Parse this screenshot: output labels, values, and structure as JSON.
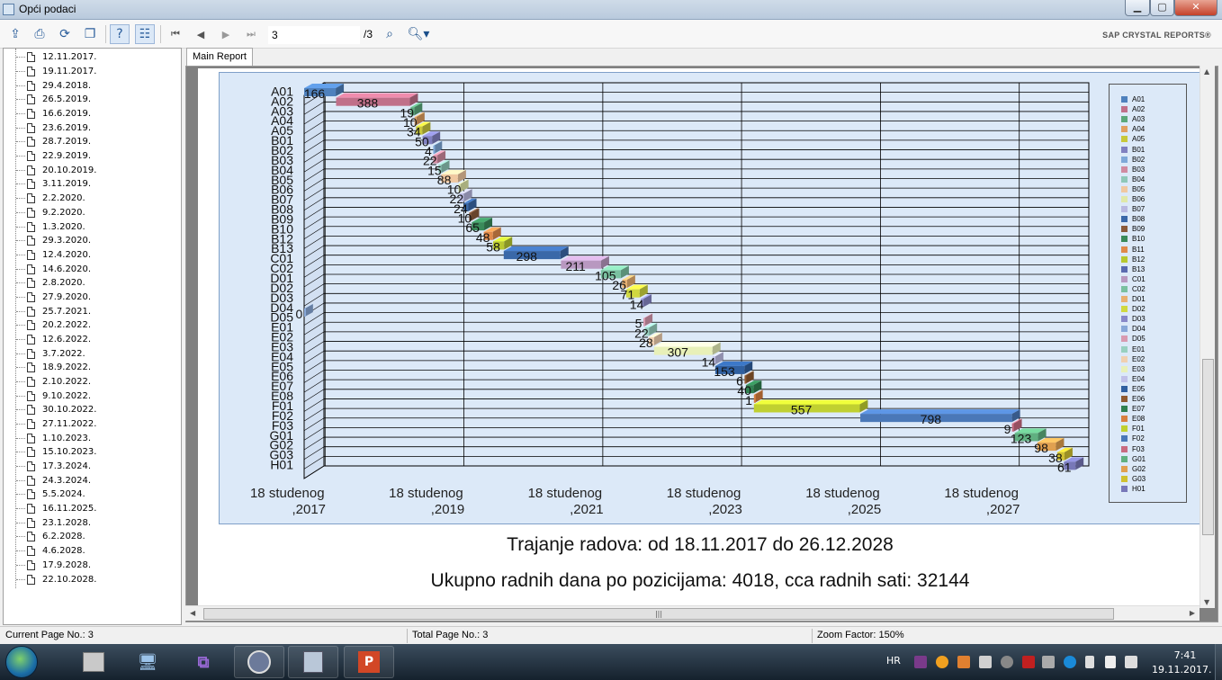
{
  "window": {
    "title": "Opći podaci"
  },
  "toolbar": {
    "page_value": "3",
    "page_total": "/3",
    "brand": "SAP CRYSTAL REPORTS®"
  },
  "tree": {
    "items": [
      "12.11.2017.",
      "19.11.2017.",
      "29.4.2018.",
      "26.5.2019.",
      "16.6.2019.",
      "23.6.2019.",
      "28.7.2019.",
      "22.9.2019.",
      "20.10.2019.",
      "3.11.2019.",
      "2.2.2020.",
      "9.2.2020.",
      "1.3.2020.",
      "29.3.2020.",
      "12.4.2020.",
      "14.6.2020.",
      "2.8.2020.",
      "27.9.2020.",
      "25.7.2021.",
      "20.2.2022.",
      "12.6.2022.",
      "3.7.2022.",
      "18.9.2022.",
      "2.10.2022.",
      "9.10.2022.",
      "30.10.2022.",
      "27.11.2022.",
      "1.10.2023.",
      "15.10.2023.",
      "17.3.2024.",
      "24.3.2024.",
      "5.5.2024.",
      "16.11.2025.",
      "23.1.2028.",
      "6.2.2028.",
      "4.6.2028.",
      "17.9.2028.",
      "22.10.2028."
    ]
  },
  "tabs": {
    "main": "Main Report"
  },
  "report": {
    "summary_duration": "Trajanje radova: od 18.11.2017 do 26.12.2028",
    "summary_workdays": "Ukupno radnih dana po pozicijama: 4018, cca radnih sati: 32144"
  },
  "chart_data": {
    "type": "bar",
    "orientation": "horizontal-gantt",
    "x_ticks": [
      {
        "line1": "18 studenog",
        "line2": ",2017"
      },
      {
        "line1": "18 studenog",
        "line2": ",2019"
      },
      {
        "line1": "18 studenog",
        "line2": ",2021"
      },
      {
        "line1": "18 studenog",
        "line2": ",2023"
      },
      {
        "line1": "18 studenog",
        "line2": ",2025"
      },
      {
        "line1": "18 studenog",
        "line2": ",2027"
      }
    ],
    "xlim": [
      "2017-11-12",
      "2028-11-18"
    ],
    "categories_shown": [
      "A01",
      "A02",
      "A03",
      "A04",
      "A05",
      "B01",
      "B02",
      "B03",
      "B04",
      "B05",
      "B06",
      "B07",
      "B08",
      "B09",
      "B10",
      "B12",
      "B13",
      "C01",
      "C02",
      "D01",
      "D02",
      "D03",
      "D04",
      "D05",
      "E01",
      "E02",
      "E03",
      "E04",
      "E05",
      "E06",
      "E07",
      "E08",
      "F01",
      "F02",
      "F03",
      "G01",
      "G02",
      "G03",
      "H01"
    ],
    "legend": [
      {
        "name": "A01",
        "color": "#4f81bd"
      },
      {
        "name": "A02",
        "color": "#c0708a"
      },
      {
        "name": "A03",
        "color": "#5aa87a"
      },
      {
        "name": "A04",
        "color": "#e0a060"
      },
      {
        "name": "A05",
        "color": "#c8c83a"
      },
      {
        "name": "B01",
        "color": "#8080c0"
      },
      {
        "name": "B02",
        "color": "#7fa8d8"
      },
      {
        "name": "B03",
        "color": "#d08aa0"
      },
      {
        "name": "B04",
        "color": "#8fc8b8"
      },
      {
        "name": "B05",
        "color": "#f0c8a0"
      },
      {
        "name": "B06",
        "color": "#e0e8a8"
      },
      {
        "name": "B07",
        "color": "#b8b8e0"
      },
      {
        "name": "B08",
        "color": "#3a68a8"
      },
      {
        "name": "B09",
        "color": "#8a5a3a"
      },
      {
        "name": "B10",
        "color": "#3a8a5a"
      },
      {
        "name": "B11",
        "color": "#e08a4a"
      },
      {
        "name": "B12",
        "color": "#b8c830"
      },
      {
        "name": "B13",
        "color": "#5a6ab0"
      },
      {
        "name": "C01",
        "color": "#b898c0"
      },
      {
        "name": "C02",
        "color": "#7ac0a0"
      },
      {
        "name": "D01",
        "color": "#e8b070"
      },
      {
        "name": "D02",
        "color": "#d0d840"
      },
      {
        "name": "D03",
        "color": "#8888c8"
      },
      {
        "name": "D04",
        "color": "#88a8d8"
      },
      {
        "name": "D05",
        "color": "#d89ab0"
      },
      {
        "name": "E01",
        "color": "#98d0c0"
      },
      {
        "name": "E02",
        "color": "#f0d0b0"
      },
      {
        "name": "E03",
        "color": "#e8f0b8"
      },
      {
        "name": "E04",
        "color": "#c0c0e8"
      },
      {
        "name": "E05",
        "color": "#3060a0"
      },
      {
        "name": "E06",
        "color": "#905a30"
      },
      {
        "name": "E07",
        "color": "#308050"
      },
      {
        "name": "E08",
        "color": "#d88040"
      },
      {
        "name": "F01",
        "color": "#c0d030"
      },
      {
        "name": "F02",
        "color": "#4a78b8"
      },
      {
        "name": "F03",
        "color": "#c86a80"
      },
      {
        "name": "G01",
        "color": "#60b080"
      },
      {
        "name": "G02",
        "color": "#e0a050"
      },
      {
        "name": "G03",
        "color": "#d0c030"
      },
      {
        "name": "H01",
        "color": "#7878b8"
      }
    ],
    "bars": [
      {
        "label": "A01",
        "start": "2017-11-12",
        "days": 166,
        "color": "#4f81bd"
      },
      {
        "label": "A02",
        "start": "2018-04-29",
        "days": 388,
        "color": "#c0708a"
      },
      {
        "label": "A03",
        "start": "2019-05-26",
        "days": 19,
        "color": "#5aa87a"
      },
      {
        "label": "A04",
        "start": "2019-06-16",
        "days": 10,
        "color": "#e0a060"
      },
      {
        "label": "A05",
        "start": "2019-06-23",
        "days": 34,
        "color": "#c8c83a"
      },
      {
        "label": "B01",
        "start": "2019-07-28",
        "days": 50,
        "color": "#8080c0"
      },
      {
        "label": "B02",
        "start": "2019-09-22",
        "days": 4,
        "color": "#7fa8d8"
      },
      {
        "label": "B03",
        "start": "2019-09-22",
        "days": 22,
        "color": "#d08aa0"
      },
      {
        "label": "B04",
        "start": "2019-10-20",
        "days": 15,
        "color": "#8fc8b8"
      },
      {
        "label": "B05",
        "start": "2019-11-03",
        "days": 88,
        "color": "#f0c8a0"
      },
      {
        "label": "B06",
        "start": "2020-02-02",
        "days": 10,
        "color": "#e0e8a8"
      },
      {
        "label": "B07",
        "start": "2020-02-09",
        "days": 22,
        "color": "#b8b8e0"
      },
      {
        "label": "B08",
        "start": "2020-03-01",
        "days": 24,
        "color": "#3a68a8"
      },
      {
        "label": "B09",
        "start": "2020-03-29",
        "days": 10,
        "color": "#8a5a3a"
      },
      {
        "label": "B10",
        "start": "2020-04-12",
        "days": 65,
        "color": "#3a8a5a"
      },
      {
        "label": "B11",
        "start": "2020-06-14",
        "days": 48,
        "color": "#e08a4a"
      },
      {
        "label": "B12",
        "start": "2020-08-02",
        "days": 58,
        "color": "#b8c830"
      },
      {
        "label": "B13",
        "start": "2020-09-27",
        "days": 298,
        "color": "#3a68a8"
      },
      {
        "label": "C01",
        "start": "2021-07-25",
        "days": 211,
        "color": "#b898c0"
      },
      {
        "label": "C02",
        "start": "2022-02-20",
        "days": 105,
        "color": "#7ac0a0"
      },
      {
        "label": "D01",
        "start": "2022-06-12",
        "days": 26,
        "color": "#e8b070"
      },
      {
        "label": "D02",
        "start": "2022-07-03",
        "days": 71,
        "color": "#d0d840"
      },
      {
        "label": "D03",
        "start": "2022-09-18",
        "days": 14,
        "color": "#8888c8"
      },
      {
        "label": "D04",
        "start": "2017-11-12",
        "days": 0,
        "color": "#88a8d8"
      },
      {
        "label": "D05",
        "start": "2022-10-02",
        "days": 5,
        "color": "#d89ab0"
      },
      {
        "label": "E01",
        "start": "2022-10-09",
        "days": 22,
        "color": "#98d0c0"
      },
      {
        "label": "E02",
        "start": "2022-10-30",
        "days": 28,
        "color": "#f0d0b0"
      },
      {
        "label": "E03",
        "start": "2022-11-27",
        "days": 307,
        "color": "#e8f0b8"
      },
      {
        "label": "E04",
        "start": "2023-10-01",
        "days": 14,
        "color": "#c0c0e8"
      },
      {
        "label": "E05",
        "start": "2023-10-15",
        "days": 153,
        "color": "#3060a0"
      },
      {
        "label": "E06",
        "start": "2024-03-17",
        "days": 6,
        "color": "#905a30"
      },
      {
        "label": "E07",
        "start": "2024-03-24",
        "days": 40,
        "color": "#308050"
      },
      {
        "label": "E08",
        "start": "2024-05-05",
        "days": 1,
        "color": "#d88040"
      },
      {
        "label": "F01",
        "start": "2024-05-05",
        "days": 557,
        "color": "#c0d030"
      },
      {
        "label": "F02",
        "start": "2025-11-16",
        "days": 798,
        "color": "#4a78b8"
      },
      {
        "label": "F03",
        "start": "2028-01-23",
        "days": 9,
        "color": "#c86a80"
      },
      {
        "label": "G01",
        "start": "2028-02-06",
        "days": 123,
        "color": "#60b080"
      },
      {
        "label": "G02",
        "start": "2028-06-04",
        "days": 98,
        "color": "#e0a050"
      },
      {
        "label": "G03",
        "start": "2028-09-17",
        "days": 38,
        "color": "#d0c030"
      },
      {
        "label": "H01",
        "start": "2028-10-22",
        "days": 61,
        "color": "#7878b8"
      }
    ]
  },
  "status": {
    "current_page": "Current Page No.: 3",
    "total_page": "Total Page No.: 3",
    "zoom": "Zoom Factor: 150%"
  },
  "taskbar": {
    "lang": "HR",
    "time": "7:41",
    "date": "19.11.2017."
  }
}
